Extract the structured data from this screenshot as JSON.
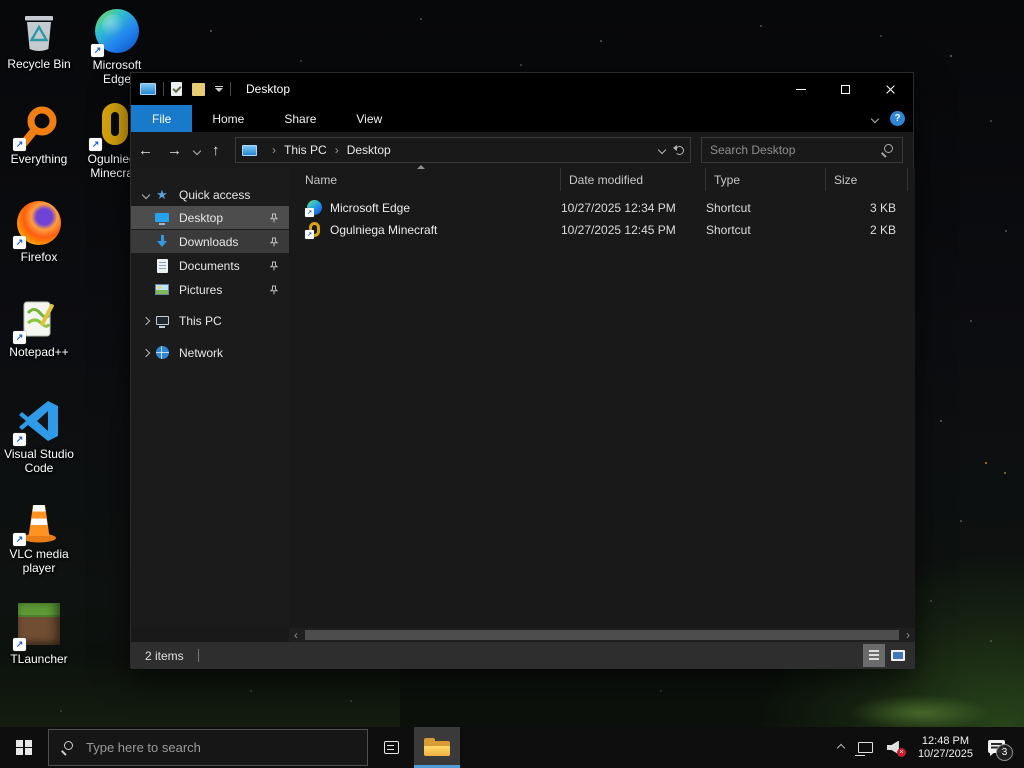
{
  "desktop": {
    "icons": [
      {
        "label": "Recycle Bin"
      },
      {
        "label": "Microsoft Edge"
      },
      {
        "label": "Everything"
      },
      {
        "label": "Ogulniega Minecraft"
      },
      {
        "label": "Firefox"
      },
      {
        "label": "Notepad++"
      },
      {
        "label": "Visual Studio Code"
      },
      {
        "label": "VLC media player"
      },
      {
        "label": "TLauncher"
      }
    ]
  },
  "explorer": {
    "title": "Desktop",
    "tabs": {
      "file": "File",
      "home": "Home",
      "share": "Share",
      "view": "View"
    },
    "address": {
      "root": "This PC",
      "current": "Desktop"
    },
    "search_placeholder": "Search Desktop",
    "nav": {
      "quick_access": "Quick access",
      "desktop": "Desktop",
      "downloads": "Downloads",
      "documents": "Documents",
      "pictures": "Pictures",
      "this_pc": "This PC",
      "network": "Network"
    },
    "columns": {
      "name": "Name",
      "modified": "Date modified",
      "type": "Type",
      "size": "Size"
    },
    "files": [
      {
        "name": "Microsoft Edge",
        "modified": "10/27/2025 12:34 PM",
        "type": "Shortcut",
        "size": "3 KB"
      },
      {
        "name": "Ogulniega Minecraft",
        "modified": "10/27/2025 12:45 PM",
        "type": "Shortcut",
        "size": "2 KB"
      }
    ],
    "status": "2 items"
  },
  "taskbar": {
    "search_placeholder": "Type here to search",
    "clock_time": "12:48 PM",
    "clock_date": "10/27/2025",
    "notification_count": "3"
  },
  "icons": {
    "shortcut_arrow": "↗",
    "back": "←",
    "forward": "→",
    "up": "↑",
    "crumb_sep": "›",
    "star": "★",
    "help": "?",
    "scroll_left": "‹",
    "scroll_right": "›",
    "mute_x": "×"
  }
}
